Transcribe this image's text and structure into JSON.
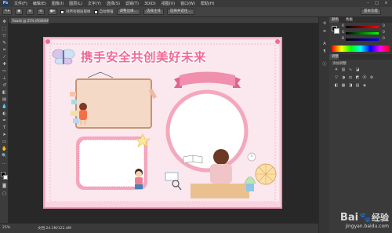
{
  "menu": {
    "app_logo": "Ps",
    "items": [
      "文件(F)",
      "编辑(E)",
      "图像(I)",
      "图层(L)",
      "文字(Y)",
      "选择(S)",
      "滤镜(T)",
      "3D(D)",
      "视图(V)",
      "窗口(W)",
      "帮助(H)"
    ],
    "window_controls": [
      "–",
      "□",
      "×"
    ]
  },
  "options": {
    "chk_all_layers": "对所有图层取样",
    "chk_enhance": "自动增强",
    "btn_refine_edge": "调整边缘...",
    "btn_select_subject": "选择主体",
    "btn_select_and_mask": "选择并遮住...",
    "workspace": "基本功能"
  },
  "document": {
    "tab_title": "Roads @ 25% (RGB/8#)"
  },
  "poster": {
    "title": "携手安全共创美好未来"
  },
  "status": {
    "zoom": "25%",
    "doc_info": "文档:24.1M/122.4M"
  },
  "panels": {
    "color_tab": "颜色",
    "swatches_tab": "色板",
    "adjust_tab": "调整",
    "adjust_subtitle": "添加调整",
    "channel_labels": [
      "R",
      "G",
      "B"
    ],
    "channel_values": [
      "0",
      "0",
      "0"
    ]
  },
  "watermark": {
    "brand": "Bai",
    "brand2": "经验",
    "url": "jingyan.baidu.com"
  },
  "colors": {
    "accent_pink": "#f49ab7",
    "title_pink": "#f06a95",
    "ribbon": "#ef7fa3"
  }
}
